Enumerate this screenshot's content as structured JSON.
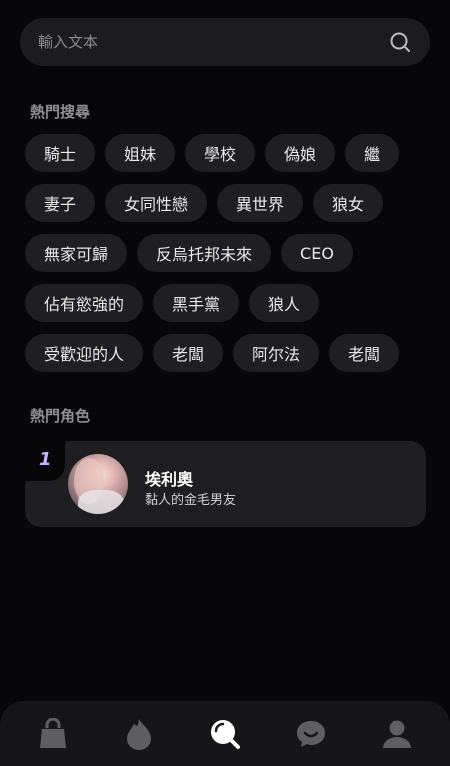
{
  "search": {
    "placeholder": "輸入文本",
    "icon": "search-icon"
  },
  "hot_search": {
    "title": "熱門搜尋",
    "rows": [
      [
        "騎士",
        "姐妹",
        "學校",
        "偽娘",
        "繼"
      ],
      [
        "妻子",
        "女同性戀",
        "異世界",
        "狼女"
      ],
      [
        "無家可歸",
        "反烏托邦未來",
        "CEO"
      ],
      [
        "佔有慾強的",
        "黑手黨",
        "狼人"
      ],
      [
        "受歡迎的人",
        "老闆",
        "阿尔法",
        "老闆"
      ]
    ]
  },
  "hot_characters": {
    "title": "熱門角色",
    "items": [
      {
        "rank": "1",
        "name": "埃利奧",
        "description": "黏人的金毛男友"
      }
    ]
  },
  "bottom_nav": {
    "items": [
      "bag-icon",
      "flame-icon",
      "search-icon",
      "chat-icon",
      "profile-icon"
    ],
    "active_index": 2
  },
  "colors": {
    "background": "#070709",
    "chip": "#1f1f22",
    "accent_rank": "#c7b3f5",
    "nav_icon": "#5e5e63",
    "nav_icon_active": "#ffffff"
  }
}
